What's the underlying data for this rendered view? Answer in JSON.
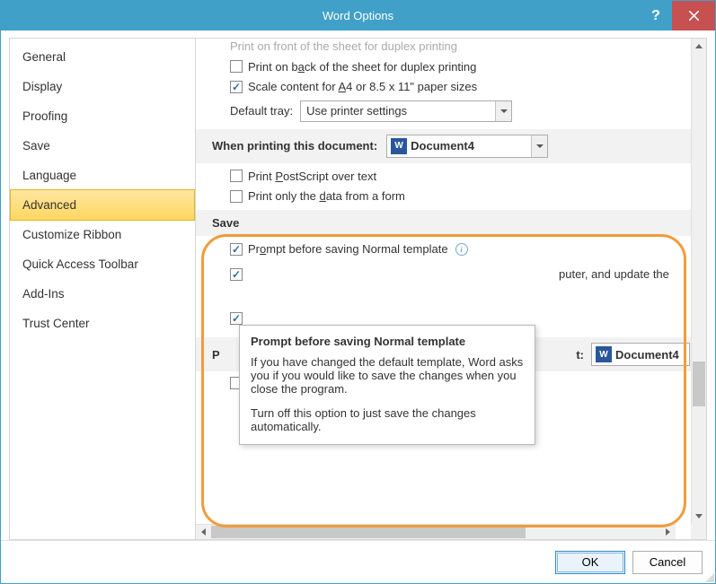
{
  "title": "Word Options",
  "sidebar": {
    "items": [
      {
        "label": "General"
      },
      {
        "label": "Display"
      },
      {
        "label": "Proofing"
      },
      {
        "label": "Save"
      },
      {
        "label": "Language"
      },
      {
        "label": "Advanced",
        "selected": true
      },
      {
        "label": "Customize Ribbon"
      },
      {
        "label": "Quick Access Toolbar"
      },
      {
        "label": "Add-Ins"
      },
      {
        "label": "Trust Center"
      }
    ]
  },
  "content": {
    "faded_line": "Print on front of the sheet for duplex printing",
    "opt_back": "Print on back of the sheet for duplex printing",
    "opt_scale": "Scale content for A4 or 8.5 x 11\" paper sizes",
    "default_tray_label": "Default tray:",
    "default_tray_value": "Use printer settings",
    "group_printing": "When printing this document:",
    "doc_name": "Document4",
    "opt_postscript": "Print PostScript over text",
    "opt_formdata": "Print only the data from a form",
    "group_save": "Save",
    "opt_prompt": "Prompt before saving Normal template",
    "partial_text": "puter, and update the",
    "group_preserve_prefix": "P",
    "group_preserve_suffix": "t:"
  },
  "tooltip": {
    "title": "Prompt before saving Normal template",
    "p1": "If you have changed the default template, Word asks you if you would like to save the changes when you close the program.",
    "p2": "Turn off this option to just save the changes automatically."
  },
  "footer": {
    "ok": "OK",
    "cancel": "Cancel"
  }
}
